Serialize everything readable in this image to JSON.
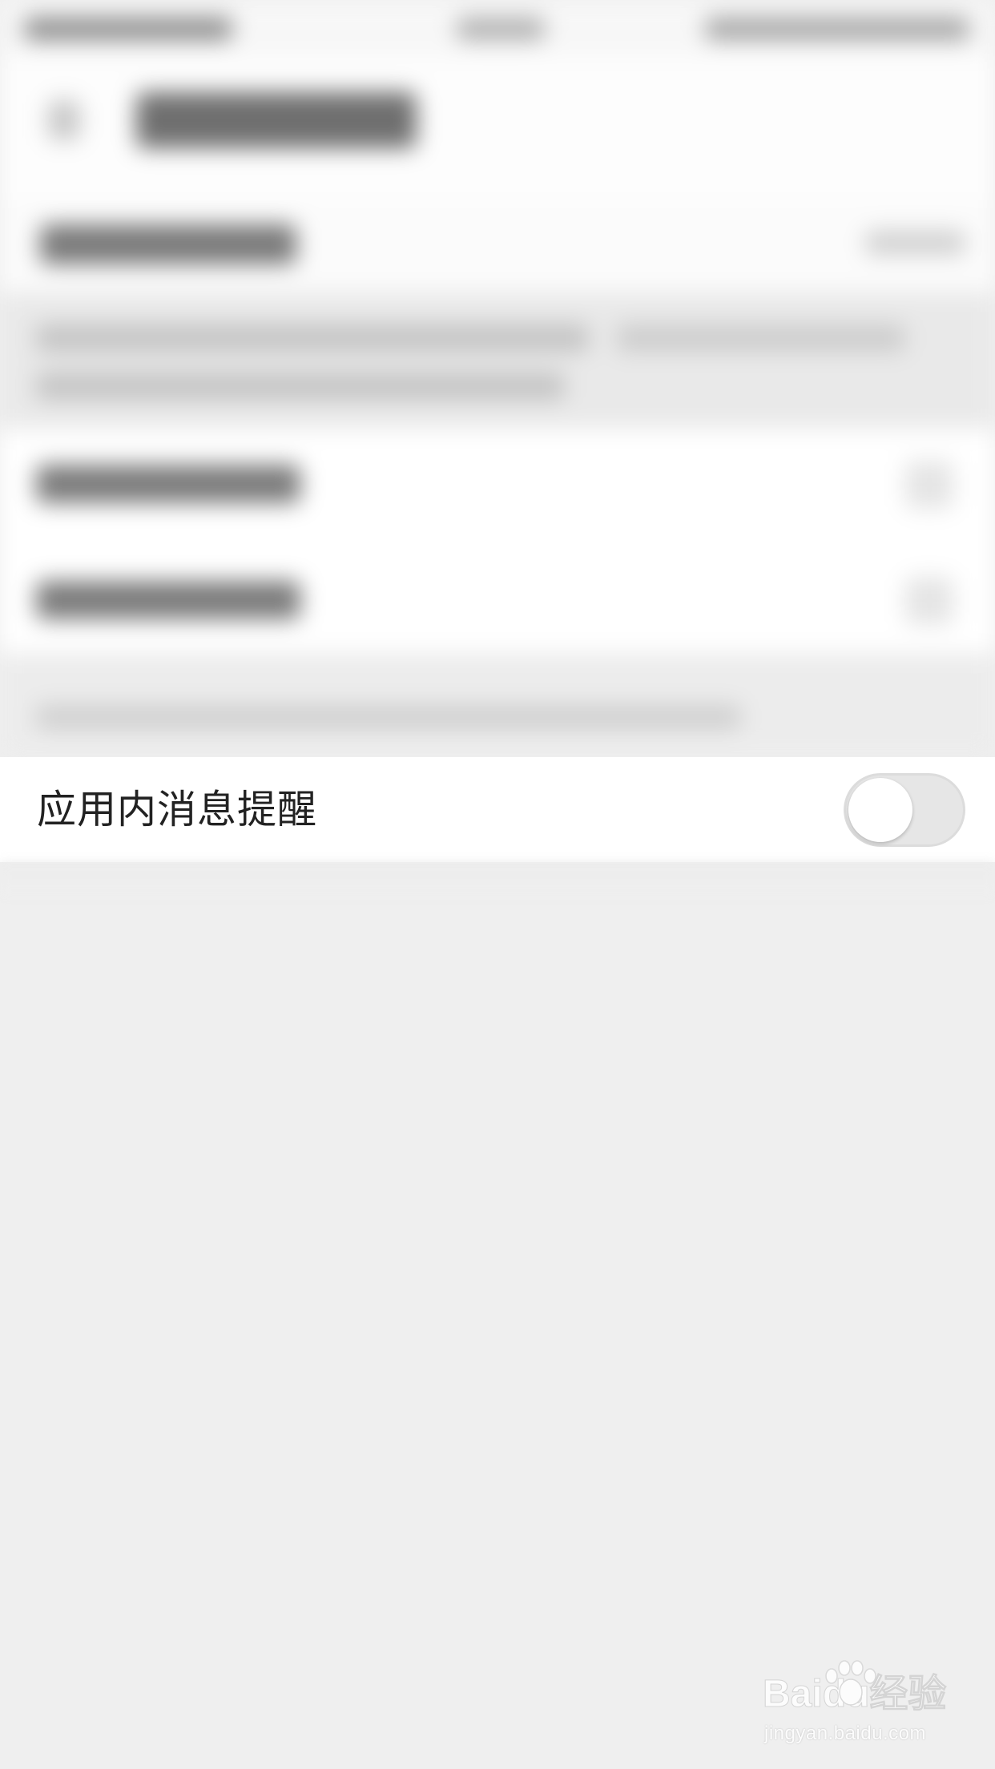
{
  "settings": {
    "in_app_notification": {
      "label": "应用内消息提醒",
      "enabled": false
    }
  },
  "watermark": {
    "logo_text": "Baidu经验",
    "url_text": "jingyan.baidu.com"
  }
}
